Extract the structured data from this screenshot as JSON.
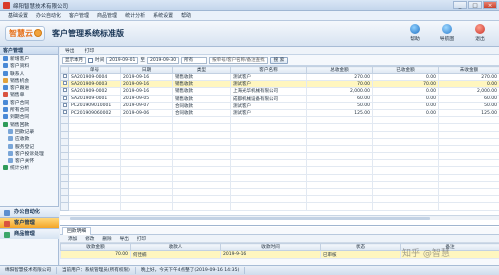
{
  "window": {
    "title": "绵阳智慧技术有限公司",
    "buttons": [
      "_",
      "□",
      "×"
    ]
  },
  "menu": [
    "基础设置",
    "办公自动化",
    "客户管理",
    "商品管理",
    "统计分析",
    "系统设置",
    "帮助"
  ],
  "banner": {
    "logo": "智慧云",
    "system_name": "客户管理系统标准版",
    "tools": [
      {
        "label": "帮助",
        "icon": "help-icon"
      },
      {
        "label": "导航图",
        "icon": "navigation-icon"
      },
      {
        "label": "退出",
        "icon": "exit-icon"
      }
    ]
  },
  "sidebar": {
    "header": "客户管理",
    "tree": [
      {
        "label": "新增客户",
        "level": 1,
        "icon_color": "#4a89d6"
      },
      {
        "label": "客户资料",
        "level": 1,
        "icon_color": "#4a89d6"
      },
      {
        "label": "联系人",
        "level": 1,
        "icon_color": "#4a89d6"
      },
      {
        "label": "销售机会",
        "level": 1,
        "icon_color": "#e3a23b"
      },
      {
        "label": "客户跟进",
        "level": 1,
        "icon_color": "#4a89d6"
      },
      {
        "label": "销售单",
        "level": 1,
        "icon_color": "#d9533f"
      },
      {
        "label": "客户合同",
        "level": 1,
        "icon_color": "#4a89d6"
      },
      {
        "label": "所有合同",
        "level": 1,
        "icon_color": "#4a89d6"
      },
      {
        "label": "到期合同",
        "level": 1,
        "icon_color": "#4a89d6"
      },
      {
        "label": "销售回款",
        "level": 1,
        "icon_color": "#2f9b5a"
      },
      {
        "label": "回款记录",
        "level": 2,
        "icon_color": "#7aa6d8"
      },
      {
        "label": "应收款",
        "level": 2,
        "icon_color": "#7aa6d8"
      },
      {
        "label": "服务登记",
        "level": 2,
        "icon_color": "#7aa6d8"
      },
      {
        "label": "客户投诉处理",
        "level": 2,
        "icon_color": "#7aa6d8"
      },
      {
        "label": "客户关怀",
        "level": 2,
        "icon_color": "#7aa6d8"
      },
      {
        "label": "统计分析",
        "level": 1,
        "icon_color": "#2f9b5a"
      }
    ],
    "groups": [
      {
        "label": "办公自动化",
        "icon_color": "#5c8fcf",
        "active": false
      },
      {
        "label": "客户管理",
        "icon_color": "#d9533f",
        "active": true
      },
      {
        "label": "商品管理",
        "icon_color": "#3aa56a",
        "active": false
      }
    ]
  },
  "toolbar": {
    "buttons": [
      "导出",
      "打印"
    ]
  },
  "filter": {
    "period": "显示本月",
    "date_label": "时间",
    "date_from": "2019-09-01",
    "to_label": "至",
    "date_to": "2019-09-30",
    "scope": "所有",
    "keyword_placeholder": "按单号/客户名称/备注查找",
    "search_button": "搜 索"
  },
  "grid": {
    "columns": [
      "单号",
      "日期",
      "类型",
      "客户名称",
      "总收金额",
      "已收金额",
      "未收金额"
    ],
    "rows": [
      [
        "SA201909-0004",
        "2019-09-16",
        "销售收款",
        "测试客户",
        "270.00",
        "0.00",
        "270.00"
      ],
      [
        "SA201909-0003",
        "2019-09-16",
        "销售收款",
        "测试客户",
        "70.00",
        "70.00",
        "0.00"
      ],
      [
        "SA201909-0002",
        "2019-09-16",
        "销售收款",
        "上海光华机械有限公司",
        "2,000.00",
        "0.00",
        "2,000.00"
      ],
      [
        "SA201909-0001",
        "2019-09-05",
        "销售收款",
        "成都机械设备有限公司",
        "60.00",
        "0.00",
        "60.00"
      ],
      [
        "PC201909010001",
        "2019-09-07",
        "合同收款",
        "测试客户",
        "50.00",
        "0.00",
        "50.00"
      ],
      [
        "PC201909060002",
        "2019-09-06",
        "合同收款",
        "测试客户",
        "125.00",
        "0.00",
        "125.00"
      ]
    ],
    "selected_row": 1
  },
  "detail": {
    "tab": "回款明细",
    "toolbar": [
      "添加",
      "修改",
      "删除",
      "导出",
      "打印"
    ],
    "columns": [
      "收款金额",
      "收款人",
      "收款时间",
      "状态",
      "备注"
    ],
    "rows": [
      [
        "70.00",
        "何佳楠",
        "2019-9-16",
        "已审核",
        ""
      ]
    ]
  },
  "status": {
    "company": "绵阳智慧技术有限公司",
    "user": "当前用户：系统管理员(所有权限)",
    "time": "晚上好，今天下午4点整了(2019-09-16 14:35)"
  },
  "watermark": "知乎 @智慧"
}
